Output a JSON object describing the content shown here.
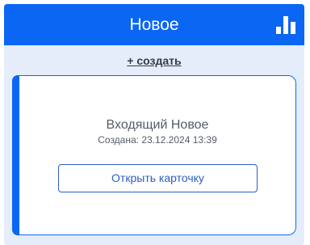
{
  "header": {
    "title": "Новое",
    "stats_icon": "bar-chart-icon"
  },
  "create_link": "+ создать",
  "card": {
    "title": "Входящий Новое",
    "created": "Создана: 23.12.2024 13:39",
    "open_button": "Открыть карточку"
  },
  "colors": {
    "accent": "#0b66f4",
    "panel_bg": "#e5edfb",
    "button_text": "#2c5ec8"
  }
}
